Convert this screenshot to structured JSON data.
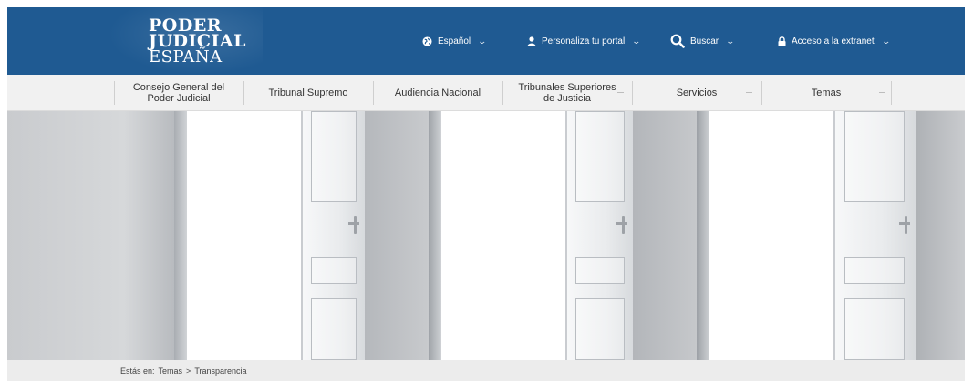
{
  "header": {
    "logo": {
      "line1": "PODER",
      "line2": "JUDICIAL",
      "line3": "ESPAÑA"
    },
    "language": {
      "label": "Español",
      "icon": "globe-icon"
    },
    "personalize": {
      "label": "Personaliza tu portal",
      "icon": "user-icon"
    },
    "search": {
      "label": "Buscar",
      "icon": "search-icon"
    },
    "extranet": {
      "label": "Acceso a la extranet",
      "icon": "lock-icon"
    },
    "colors": {
      "background": "#1f5a92",
      "text": "#ffffff"
    }
  },
  "nav": {
    "items": [
      {
        "label_line1": "Consejo General del",
        "label_line2": "Poder Judicial"
      },
      {
        "label_line1": "Tribunal Supremo",
        "label_line2": ""
      },
      {
        "label_line1": "Audiencia Nacional",
        "label_line2": ""
      },
      {
        "label_line1": "Tribunales Superiores",
        "label_line2": "de Justicia"
      },
      {
        "label_line1": "Servicios",
        "label_line2": ""
      },
      {
        "label_line1": "Temas",
        "label_line2": ""
      }
    ]
  },
  "breadcrumb": {
    "prefix": "Estás en:",
    "items": [
      "Temas",
      "Transparencia"
    ],
    "separator": ">"
  }
}
